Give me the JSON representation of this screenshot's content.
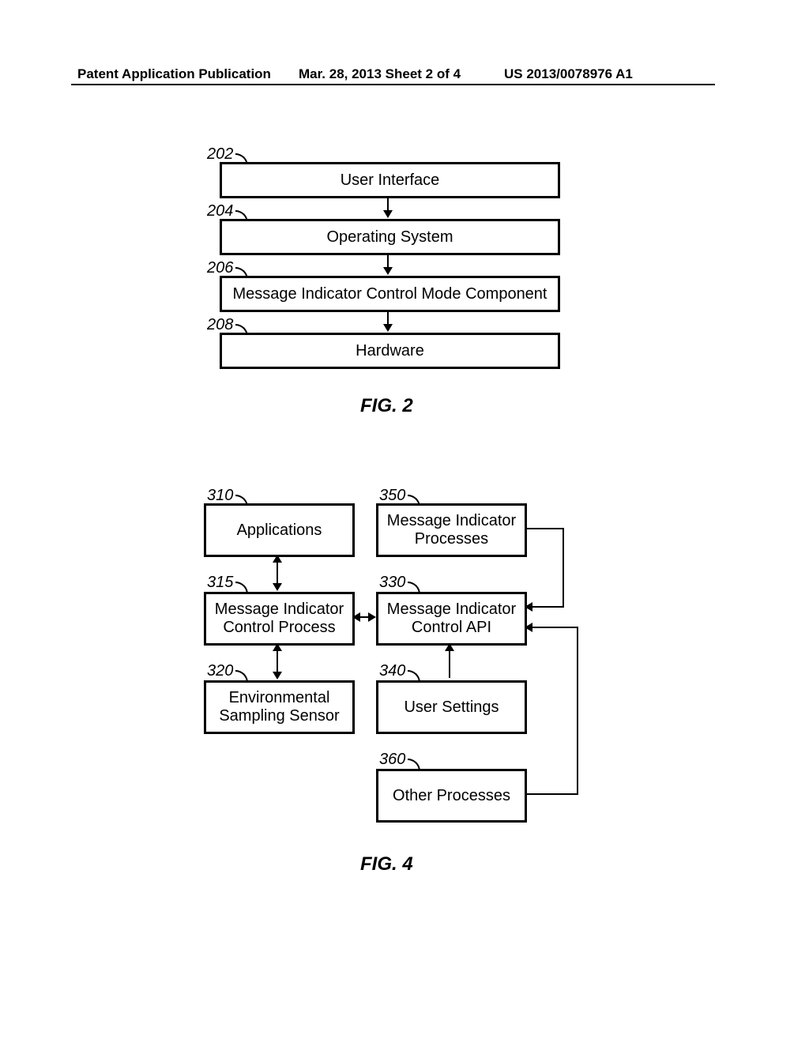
{
  "header": {
    "left": "Patent Application Publication",
    "mid": "Mar. 28, 2013  Sheet 2 of 4",
    "right": "US 2013/0078976 A1"
  },
  "fig2": {
    "caption": "FIG. 2",
    "boxes": {
      "b202": {
        "ref": "202",
        "label": "User Interface"
      },
      "b204": {
        "ref": "204",
        "label": "Operating System"
      },
      "b206": {
        "ref": "206",
        "label": "Message Indicator Control Mode Component"
      },
      "b208": {
        "ref": "208",
        "label": "Hardware"
      }
    }
  },
  "fig4": {
    "caption": "FIG. 4",
    "boxes": {
      "b310": {
        "ref": "310",
        "label": "Applications"
      },
      "b315": {
        "ref": "315",
        "label": "Message Indicator\nControl Process"
      },
      "b320": {
        "ref": "320",
        "label": "Environmental\nSampling Sensor"
      },
      "b330": {
        "ref": "330",
        "label": "Message Indicator\nControl API"
      },
      "b340": {
        "ref": "340",
        "label": "User Settings"
      },
      "b350": {
        "ref": "350",
        "label": "Message Indicator\nProcesses"
      },
      "b360": {
        "ref": "360",
        "label": "Other Processes"
      }
    }
  },
  "chart_data": [
    {
      "type": "diagram",
      "figure": "FIG. 2",
      "nodes": [
        {
          "id": "202",
          "label": "User Interface"
        },
        {
          "id": "204",
          "label": "Operating System"
        },
        {
          "id": "206",
          "label": "Message Indicator Control Mode Component"
        },
        {
          "id": "208",
          "label": "Hardware"
        }
      ],
      "edges": [
        {
          "from": "202",
          "to": "204",
          "dir": "down"
        },
        {
          "from": "204",
          "to": "206",
          "dir": "down"
        },
        {
          "from": "206",
          "to": "208",
          "dir": "down"
        }
      ]
    },
    {
      "type": "diagram",
      "figure": "FIG. 4",
      "nodes": [
        {
          "id": "310",
          "label": "Applications"
        },
        {
          "id": "315",
          "label": "Message Indicator Control Process"
        },
        {
          "id": "320",
          "label": "Environmental Sampling Sensor"
        },
        {
          "id": "330",
          "label": "Message Indicator Control API"
        },
        {
          "id": "340",
          "label": "User Settings"
        },
        {
          "id": "350",
          "label": "Message Indicator Processes"
        },
        {
          "id": "360",
          "label": "Other Processes"
        }
      ],
      "edges": [
        {
          "from": "310",
          "to": "315",
          "dir": "bidirectional"
        },
        {
          "from": "315",
          "to": "320",
          "dir": "bidirectional"
        },
        {
          "from": "315",
          "to": "330",
          "dir": "bidirectional"
        },
        {
          "from": "340",
          "to": "330",
          "dir": "up"
        },
        {
          "from": "350",
          "to": "330",
          "dir": "to-330"
        },
        {
          "from": "360",
          "to": "330",
          "dir": "to-330"
        }
      ]
    }
  ]
}
